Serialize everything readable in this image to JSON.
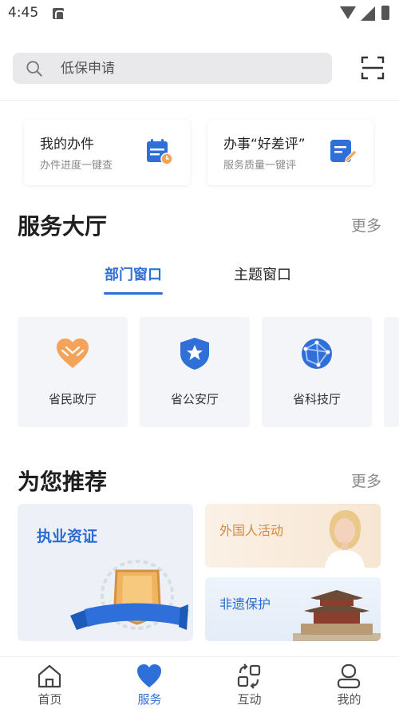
{
  "status_bar": {
    "time": "4:45"
  },
  "search": {
    "placeholder": "低保申请"
  },
  "quick_cards": [
    {
      "title": "我的办件",
      "subtitle": "办件进度一键查",
      "icon": "calendar-clock-icon"
    },
    {
      "title": "办事“好差评”",
      "subtitle": "服务质量一键评",
      "icon": "edit-note-icon"
    }
  ],
  "service_hall": {
    "title": "服务大厅",
    "more": "更多",
    "tabs": [
      {
        "label": "部门窗口",
        "active": true
      },
      {
        "label": "主题窗口",
        "active": false
      }
    ],
    "departments": [
      {
        "label": "省民政厅",
        "icon": "heart-hands-icon"
      },
      {
        "label": "省公安厅",
        "icon": "police-badge-icon"
      },
      {
        "label": "省科技厅",
        "icon": "globe-network-icon"
      }
    ]
  },
  "recommend": {
    "title": "为您推荐",
    "more": "更多",
    "items": [
      {
        "label": "执业资证"
      },
      {
        "label": "外国人活动"
      },
      {
        "label": "非遗保护"
      }
    ]
  },
  "bottom_nav": [
    {
      "label": "首页",
      "icon": "home-icon",
      "active": false
    },
    {
      "label": "服务",
      "icon": "heart-icon",
      "active": true
    },
    {
      "label": "互动",
      "icon": "exchange-icon",
      "active": false
    },
    {
      "label": "我的",
      "icon": "user-icon",
      "active": false
    }
  ],
  "colors": {
    "accent": "#2f6fd9",
    "orange": "#f3a35a",
    "card_bg": "#f3f5f8"
  }
}
